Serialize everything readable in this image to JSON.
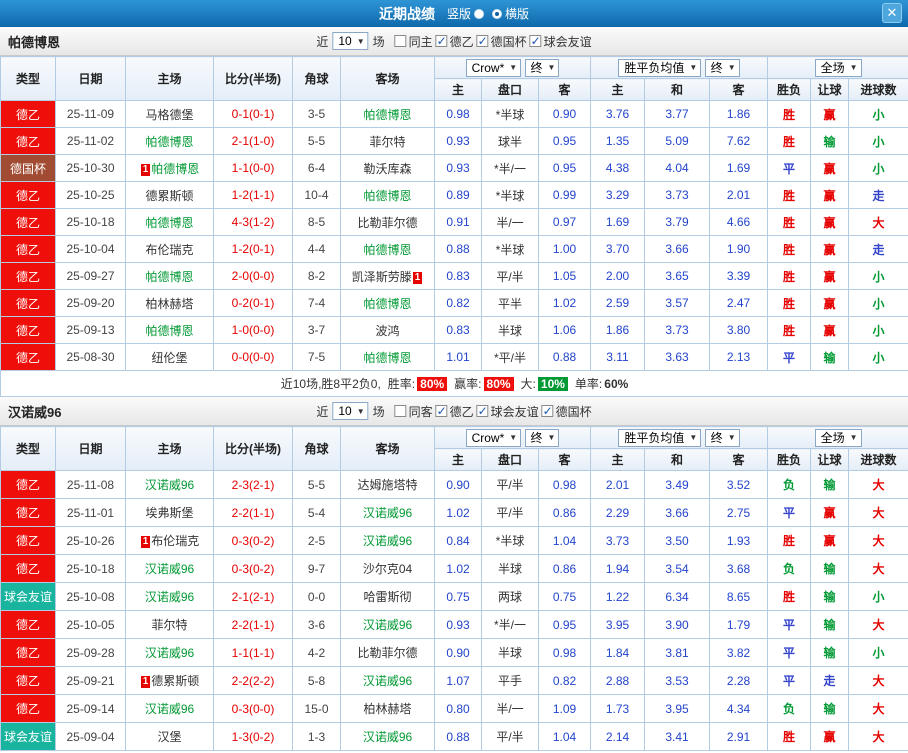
{
  "topbar": {
    "title": "近期战绩",
    "options": [
      {
        "label": "竖版",
        "selected": false
      },
      {
        "label": "横版",
        "selected": true
      }
    ],
    "close_icon": "✕"
  },
  "filter": {
    "near": "近",
    "games": "场"
  },
  "columns": {
    "type": "类型",
    "date": "日期",
    "home": "主场",
    "score": "比分(半场)",
    "corner": "角球",
    "away": "客场",
    "src_label": "Crow*",
    "final_label": "终",
    "home_short": "主",
    "handicap": "盘口",
    "away_short": "客",
    "avg_label": "胜平负均值",
    "draw_short": "和",
    "scope_label": "全场",
    "result": "胜负",
    "result_handicap": "让球",
    "result_goals": "进球数"
  },
  "palette": {
    "topbar_blue": "#0f68ac",
    "league_red": "#ee0f0a",
    "league_cup_brown": "#a04b32",
    "league_friendly_teal": "#18b49e",
    "focus_team_green": "#009933",
    "score_red": "#e60000",
    "odds_blue": "#2244cc",
    "result_blue": "#3344cc"
  },
  "league_class": {
    "德乙": "lg-red",
    "德国杯": "lg-cup",
    "球会友谊": "lg-teal"
  },
  "result_class": {
    "胜": "c-red",
    "赢": "c-red",
    "大": "c-red",
    "平": "c-blue",
    "走": "c-blue",
    "负": "c-green",
    "输": "c-green",
    "小": "c-green"
  },
  "sections": [
    {
      "team": "帕德博恩",
      "count": "10",
      "checkboxes": [
        {
          "label": "同主",
          "checked": false
        },
        {
          "label": "德乙",
          "checked": true
        },
        {
          "label": "德国杯",
          "checked": true
        },
        {
          "label": "球会友谊",
          "checked": true
        }
      ],
      "rows": [
        {
          "league": "德乙",
          "date": "25-11-09",
          "home": {
            "name": "马格德堡",
            "focus": false,
            "badge": "",
            "badge_pos": ""
          },
          "score": "0-1(0-1)",
          "corner": "3-5",
          "away": {
            "name": "帕德博恩",
            "focus": true,
            "badge": "",
            "badge_pos": ""
          },
          "odds": [
            "0.98",
            "*半球",
            "0.90"
          ],
          "avg": [
            "3.76",
            "3.77",
            "1.86"
          ],
          "results": [
            "胜",
            "赢",
            "小"
          ]
        },
        {
          "league": "德乙",
          "date": "25-11-02",
          "home": {
            "name": "帕德博恩",
            "focus": true,
            "badge": "",
            "badge_pos": ""
          },
          "score": "2-1(1-0)",
          "corner": "5-5",
          "away": {
            "name": "菲尔特",
            "focus": false,
            "badge": "",
            "badge_pos": ""
          },
          "odds": [
            "0.93",
            "球半",
            "0.95"
          ],
          "avg": [
            "1.35",
            "5.09",
            "7.62"
          ],
          "results": [
            "胜",
            "输",
            "小"
          ]
        },
        {
          "league": "德国杯",
          "date": "25-10-30",
          "home": {
            "name": "帕德博恩",
            "focus": true,
            "badge": "1",
            "badge_pos": "before"
          },
          "score": "1-1(0-0)",
          "corner": "6-4",
          "away": {
            "name": "勒沃库森",
            "focus": false,
            "badge": "",
            "badge_pos": ""
          },
          "odds": [
            "0.93",
            "*半/一",
            "0.95"
          ],
          "avg": [
            "4.38",
            "4.04",
            "1.69"
          ],
          "results": [
            "平",
            "赢",
            "小"
          ]
        },
        {
          "league": "德乙",
          "date": "25-10-25",
          "home": {
            "name": "德累斯顿",
            "focus": false,
            "badge": "",
            "badge_pos": ""
          },
          "score": "1-2(1-1)",
          "corner": "10-4",
          "away": {
            "name": "帕德博恩",
            "focus": true,
            "badge": "",
            "badge_pos": ""
          },
          "odds": [
            "0.89",
            "*半球",
            "0.99"
          ],
          "avg": [
            "3.29",
            "3.73",
            "2.01"
          ],
          "results": [
            "胜",
            "赢",
            "走"
          ]
        },
        {
          "league": "德乙",
          "date": "25-10-18",
          "home": {
            "name": "帕德博恩",
            "focus": true,
            "badge": "",
            "badge_pos": ""
          },
          "score": "4-3(1-2)",
          "corner": "8-5",
          "away": {
            "name": "比勒菲尔德",
            "focus": false,
            "badge": "",
            "badge_pos": ""
          },
          "odds": [
            "0.91",
            "半/一",
            "0.97"
          ],
          "avg": [
            "1.69",
            "3.79",
            "4.66"
          ],
          "results": [
            "胜",
            "赢",
            "大"
          ]
        },
        {
          "league": "德乙",
          "date": "25-10-04",
          "home": {
            "name": "布伦瑞克",
            "focus": false,
            "badge": "",
            "badge_pos": ""
          },
          "score": "1-2(0-1)",
          "corner": "4-4",
          "away": {
            "name": "帕德博恩",
            "focus": true,
            "badge": "",
            "badge_pos": ""
          },
          "odds": [
            "0.88",
            "*半球",
            "1.00"
          ],
          "avg": [
            "3.70",
            "3.66",
            "1.90"
          ],
          "results": [
            "胜",
            "赢",
            "走"
          ]
        },
        {
          "league": "德乙",
          "date": "25-09-27",
          "home": {
            "name": "帕德博恩",
            "focus": true,
            "badge": "",
            "badge_pos": ""
          },
          "score": "2-0(0-0)",
          "corner": "8-2",
          "away": {
            "name": "凯泽斯劳滕",
            "focus": false,
            "badge": "1",
            "badge_pos": "after"
          },
          "odds": [
            "0.83",
            "平/半",
            "1.05"
          ],
          "avg": [
            "2.00",
            "3.65",
            "3.39"
          ],
          "results": [
            "胜",
            "赢",
            "小"
          ]
        },
        {
          "league": "德乙",
          "date": "25-09-20",
          "home": {
            "name": "柏林赫塔",
            "focus": false,
            "badge": "",
            "badge_pos": ""
          },
          "score": "0-2(0-1)",
          "corner": "7-4",
          "away": {
            "name": "帕德博恩",
            "focus": true,
            "badge": "",
            "badge_pos": ""
          },
          "odds": [
            "0.82",
            "平半",
            "1.02"
          ],
          "avg": [
            "2.59",
            "3.57",
            "2.47"
          ],
          "results": [
            "胜",
            "赢",
            "小"
          ]
        },
        {
          "league": "德乙",
          "date": "25-09-13",
          "home": {
            "name": "帕德博恩",
            "focus": true,
            "badge": "",
            "badge_pos": ""
          },
          "score": "1-0(0-0)",
          "corner": "3-7",
          "away": {
            "name": "波鸿",
            "focus": false,
            "badge": "",
            "badge_pos": ""
          },
          "odds": [
            "0.83",
            "半球",
            "1.06"
          ],
          "avg": [
            "1.86",
            "3.73",
            "3.80"
          ],
          "results": [
            "胜",
            "赢",
            "小"
          ]
        },
        {
          "league": "德乙",
          "date": "25-08-30",
          "home": {
            "name": "纽伦堡",
            "focus": false,
            "badge": "",
            "badge_pos": ""
          },
          "score": "0-0(0-0)",
          "corner": "7-5",
          "away": {
            "name": "帕德博恩",
            "focus": true,
            "badge": "",
            "badge_pos": ""
          },
          "odds": [
            "1.01",
            "*平/半",
            "0.88"
          ],
          "avg": [
            "3.11",
            "3.63",
            "2.13"
          ],
          "results": [
            "平",
            "输",
            "小"
          ]
        }
      ],
      "summary": {
        "prefix": "近10场,胜8平2负0,",
        "stats": [
          {
            "label": "胜率:",
            "value": "80%",
            "cls": "red"
          },
          {
            "label": "赢率:",
            "value": "80%",
            "cls": "red"
          },
          {
            "label": "大:",
            "value": "10%",
            "cls": "green"
          },
          {
            "label": "单率:",
            "value": "60%",
            "cls": "plain"
          }
        ]
      }
    },
    {
      "team": "汉诺威96",
      "count": "10",
      "checkboxes": [
        {
          "label": "同客",
          "checked": false
        },
        {
          "label": "德乙",
          "checked": true
        },
        {
          "label": "球会友谊",
          "checked": true
        },
        {
          "label": "德国杯",
          "checked": true
        }
      ],
      "rows": [
        {
          "league": "德乙",
          "date": "25-11-08",
          "home": {
            "name": "汉诺威96",
            "focus": true,
            "badge": "",
            "badge_pos": ""
          },
          "score": "2-3(2-1)",
          "corner": "5-5",
          "away": {
            "name": "达姆施塔特",
            "focus": false,
            "badge": "",
            "badge_pos": ""
          },
          "odds": [
            "0.90",
            "平/半",
            "0.98"
          ],
          "avg": [
            "2.01",
            "3.49",
            "3.52"
          ],
          "results": [
            "负",
            "输",
            "大"
          ]
        },
        {
          "league": "德乙",
          "date": "25-11-01",
          "home": {
            "name": "埃弗斯堡",
            "focus": false,
            "badge": "",
            "badge_pos": ""
          },
          "score": "2-2(1-1)",
          "corner": "5-4",
          "away": {
            "name": "汉诺威96",
            "focus": true,
            "badge": "",
            "badge_pos": ""
          },
          "odds": [
            "1.02",
            "平/半",
            "0.86"
          ],
          "avg": [
            "2.29",
            "3.66",
            "2.75"
          ],
          "results": [
            "平",
            "赢",
            "大"
          ]
        },
        {
          "league": "德乙",
          "date": "25-10-26",
          "home": {
            "name": "布伦瑞克",
            "focus": false,
            "badge": "1",
            "badge_pos": "before"
          },
          "score": "0-3(0-2)",
          "corner": "2-5",
          "away": {
            "name": "汉诺威96",
            "focus": true,
            "badge": "",
            "badge_pos": ""
          },
          "odds": [
            "0.84",
            "*半球",
            "1.04"
          ],
          "avg": [
            "3.73",
            "3.50",
            "1.93"
          ],
          "results": [
            "胜",
            "赢",
            "大"
          ]
        },
        {
          "league": "德乙",
          "date": "25-10-18",
          "home": {
            "name": "汉诺威96",
            "focus": true,
            "badge": "",
            "badge_pos": ""
          },
          "score": "0-3(0-2)",
          "corner": "9-7",
          "away": {
            "name": "沙尔克04",
            "focus": false,
            "badge": "",
            "badge_pos": ""
          },
          "odds": [
            "1.02",
            "半球",
            "0.86"
          ],
          "avg": [
            "1.94",
            "3.54",
            "3.68"
          ],
          "results": [
            "负",
            "输",
            "大"
          ]
        },
        {
          "league": "球会友谊",
          "date": "25-10-08",
          "home": {
            "name": "汉诺威96",
            "focus": true,
            "badge": "",
            "badge_pos": ""
          },
          "score": "2-1(2-1)",
          "corner": "0-0",
          "away": {
            "name": "哈雷斯彻",
            "focus": false,
            "badge": "",
            "badge_pos": ""
          },
          "odds": [
            "0.75",
            "两球",
            "0.75"
          ],
          "avg": [
            "1.22",
            "6.34",
            "8.65"
          ],
          "results": [
            "胜",
            "输",
            "小"
          ]
        },
        {
          "league": "德乙",
          "date": "25-10-05",
          "home": {
            "name": "菲尔特",
            "focus": false,
            "badge": "",
            "badge_pos": ""
          },
          "score": "2-2(1-1)",
          "corner": "3-6",
          "away": {
            "name": "汉诺威96",
            "focus": true,
            "badge": "",
            "badge_pos": ""
          },
          "odds": [
            "0.93",
            "*半/一",
            "0.95"
          ],
          "avg": [
            "3.95",
            "3.90",
            "1.79"
          ],
          "results": [
            "平",
            "输",
            "大"
          ]
        },
        {
          "league": "德乙",
          "date": "25-09-28",
          "home": {
            "name": "汉诺威96",
            "focus": true,
            "badge": "",
            "badge_pos": ""
          },
          "score": "1-1(1-1)",
          "corner": "4-2",
          "away": {
            "name": "比勒菲尔德",
            "focus": false,
            "badge": "",
            "badge_pos": ""
          },
          "odds": [
            "0.90",
            "半球",
            "0.98"
          ],
          "avg": [
            "1.84",
            "3.81",
            "3.82"
          ],
          "results": [
            "平",
            "输",
            "小"
          ]
        },
        {
          "league": "德乙",
          "date": "25-09-21",
          "home": {
            "name": "德累斯顿",
            "focus": false,
            "badge": "1",
            "badge_pos": "before"
          },
          "score": "2-2(2-2)",
          "corner": "5-8",
          "away": {
            "name": "汉诺威96",
            "focus": true,
            "badge": "",
            "badge_pos": ""
          },
          "odds": [
            "1.07",
            "平手",
            "0.82"
          ],
          "avg": [
            "2.88",
            "3.53",
            "2.28"
          ],
          "results": [
            "平",
            "走",
            "大"
          ]
        },
        {
          "league": "德乙",
          "date": "25-09-14",
          "home": {
            "name": "汉诺威96",
            "focus": true,
            "badge": "",
            "badge_pos": ""
          },
          "score": "0-3(0-0)",
          "corner": "15-0",
          "away": {
            "name": "柏林赫塔",
            "focus": false,
            "badge": "",
            "badge_pos": ""
          },
          "odds": [
            "0.80",
            "半/一",
            "1.09"
          ],
          "avg": [
            "1.73",
            "3.95",
            "4.34"
          ],
          "results": [
            "负",
            "输",
            "大"
          ]
        },
        {
          "league": "球会友谊",
          "date": "25-09-04",
          "home": {
            "name": "汉堡",
            "focus": false,
            "badge": "",
            "badge_pos": ""
          },
          "score": "1-3(0-2)",
          "corner": "1-3",
          "away": {
            "name": "汉诺威96",
            "focus": true,
            "badge": "",
            "badge_pos": ""
          },
          "odds": [
            "0.88",
            "平/半",
            "1.04"
          ],
          "avg": [
            "2.14",
            "3.41",
            "2.91"
          ],
          "results": [
            "胜",
            "赢",
            "大"
          ]
        }
      ],
      "summary": null
    }
  ]
}
